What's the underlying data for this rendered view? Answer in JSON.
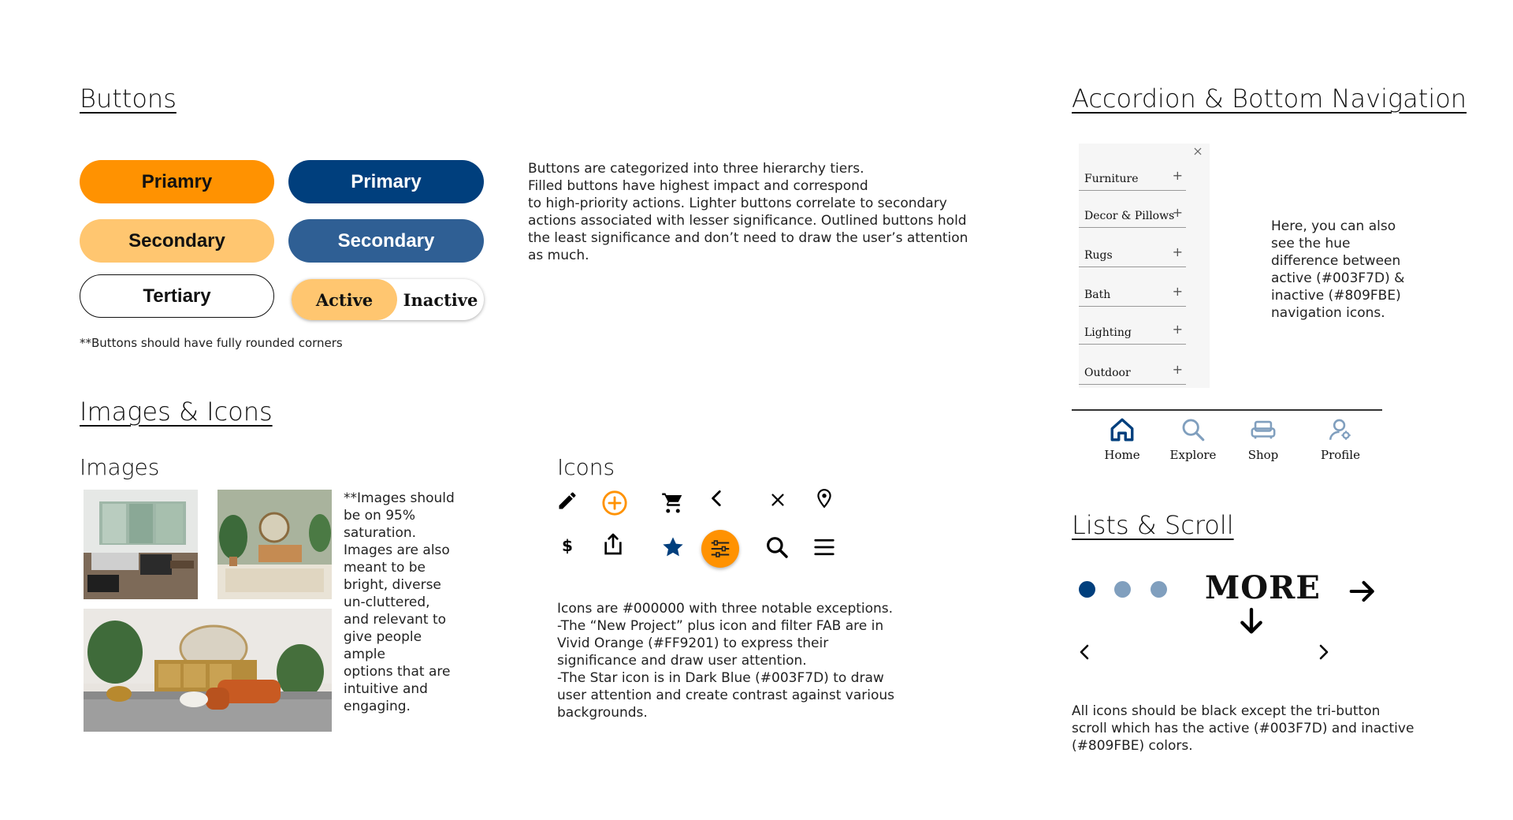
{
  "buttons_section": {
    "title": "Buttons",
    "primary_orange_label": "Priamry",
    "primary_blue_label": "Primary",
    "secondary_light_label": "Secondary",
    "secondary_blue_label": "Secondary",
    "tertiary_label": "Tertiary",
    "toggle_active_label": "Active",
    "toggle_inactive_label": "Inactive",
    "note": "**Buttons should have fully rounded corners",
    "description": "Buttons are categorized into three hierarchy tiers.\nFilled buttons have highest impact and correspond\nto high-priority actions. Lighter buttons correlate to secondary\nactions associated with lesser significance. Outlined buttons hold\nthe least significance and don’t need to draw the user’s attention\nas much."
  },
  "images_icons_section": {
    "title": "Images & Icons",
    "images_heading": "Images",
    "images_note": "**Images should\nbe on 95%\nsaturation.\nImages are also\nmeant to be\nbright, diverse\nun-cluttered,\nand relevant to\ngive people\nample\noptions that are\nintuitive and\nengaging.",
    "icons_heading": "Icons",
    "icons": [
      "pencil-icon",
      "plus-circle-icon",
      "cart-icon",
      "chevron-left-icon",
      "close-icon",
      "location-pin-icon",
      "dollar-icon",
      "share-icon",
      "star-icon",
      "filter-icon",
      "search-icon",
      "menu-icon"
    ],
    "icons_note": "Icons are #000000 with three notable exceptions.\n-The “New Project” plus icon and filter FAB are in\nVivid Orange (#FF9201) to express their\nsignificance and draw user attention.\n-The Star icon is in Dark Blue (#003F7D) to draw\nuser attention and create contrast against various\nbackgrounds."
  },
  "accordion_section": {
    "title": "Accordion & Bottom Navigation",
    "items": [
      {
        "label": "Furniture"
      },
      {
        "label": "Decor & Pillows"
      },
      {
        "label": "Rugs"
      },
      {
        "label": "Bath"
      },
      {
        "label": "Lighting"
      },
      {
        "label": "Outdoor"
      }
    ],
    "note": "Here, you can also\nsee the hue\ndifference between\nactive (#003F7D) &\ninactive (#809FBE)\nnavigation icons.",
    "nav": [
      {
        "label": "Home",
        "icon": "home-icon",
        "active": true
      },
      {
        "label": "Explore",
        "icon": "search-icon",
        "active": false
      },
      {
        "label": "Shop",
        "icon": "sofa-icon",
        "active": false
      },
      {
        "label": "Profile",
        "icon": "profile-icon",
        "active": false
      }
    ]
  },
  "lists_section": {
    "title": "Lists & Scroll",
    "more_label": "MORE",
    "note": "All icons should be black except the tri-button\nscroll which has the active (#003F7D) and inactive\n(#809FBE) colors."
  },
  "colors": {
    "vivid_orange": "#FF9201",
    "light_orange": "#FFC670",
    "dark_blue": "#003F7D",
    "mid_blue": "#2F5F94",
    "inactive_blue": "#809FBE",
    "black": "#000000"
  }
}
